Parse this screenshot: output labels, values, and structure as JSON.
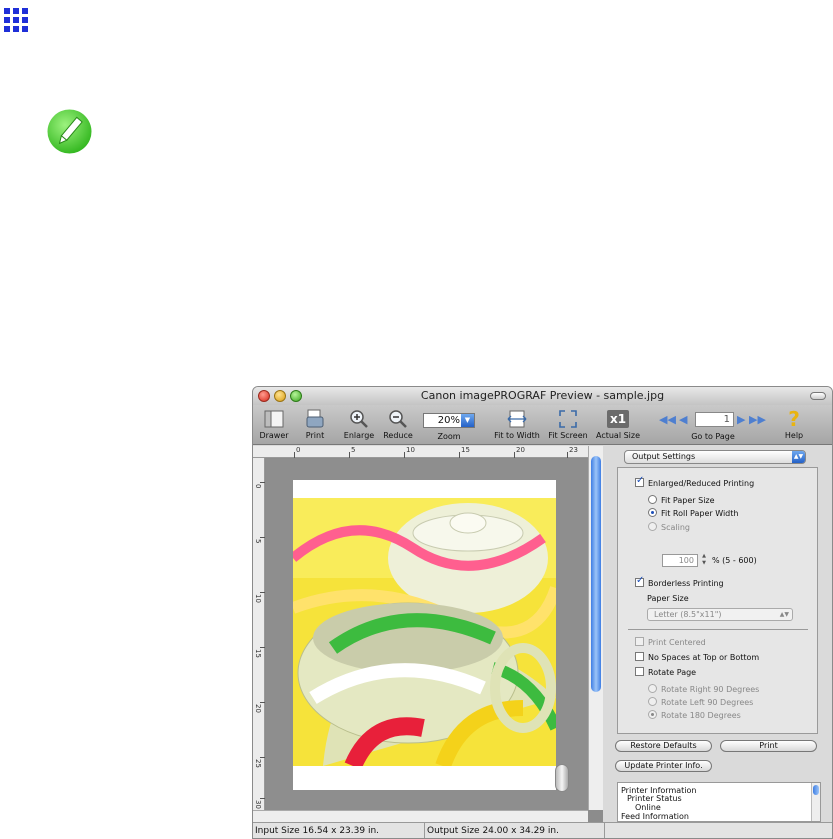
{
  "window": {
    "title": "Canon imagePROGRAF Preview - sample.jpg"
  },
  "toolbar": {
    "drawer": "Drawer",
    "print": "Print",
    "enlarge": "Enlarge",
    "reduce": "Reduce",
    "zoom_label": "Zoom",
    "zoom_value": "20%",
    "fit_to_width": "Fit to Width",
    "fit_screen": "Fit Screen",
    "actual_size": "Actual Size",
    "actual_size_glyph": "x1",
    "go_to_page": "Go to Page",
    "page_value": "1",
    "help": "Help"
  },
  "rulers": {
    "horizontal": [
      "0",
      "5",
      "10",
      "15",
      "20",
      "23"
    ],
    "vertical": [
      "0",
      "5",
      "10",
      "15",
      "20",
      "25",
      "30"
    ]
  },
  "panel": {
    "section_popup": "Output Settings",
    "enlarged_reduced": "Enlarged/Reduced Printing",
    "fit_paper_size": "Fit Paper Size",
    "fit_roll_paper_width": "Fit Roll Paper Width",
    "scaling": "Scaling",
    "scaling_value": "100",
    "scaling_range": "% (5 - 600)",
    "borderless_printing": "Borderless Printing",
    "paper_size_label": "Paper Size",
    "paper_size_value": "Letter (8.5\"x11\")",
    "print_centered": "Print Centered",
    "no_spaces": "No Spaces at Top or Bottom",
    "rotate_page": "Rotate Page",
    "rotate_right_90": "Rotate Right 90 Degrees",
    "rotate_left_90": "Rotate Left 90 Degrees",
    "rotate_180": "Rotate 180 Degrees",
    "restore_defaults": "Restore Defaults",
    "print_button": "Print",
    "update_printer_info": "Update Printer Info.",
    "info": {
      "printer_information": "Printer Information",
      "printer_status": "Printer Status",
      "online": "Online",
      "feed_information": "Feed Information"
    }
  },
  "status": {
    "input_size": "Input Size 16.54 x 23.39 in.",
    "output_size": "Output Size 24.00 x 34.29 in."
  },
  "colors": {
    "accent": "#2461c7",
    "note_icon": "#3fcf2a",
    "grid_icon": "#1f2fd8"
  }
}
